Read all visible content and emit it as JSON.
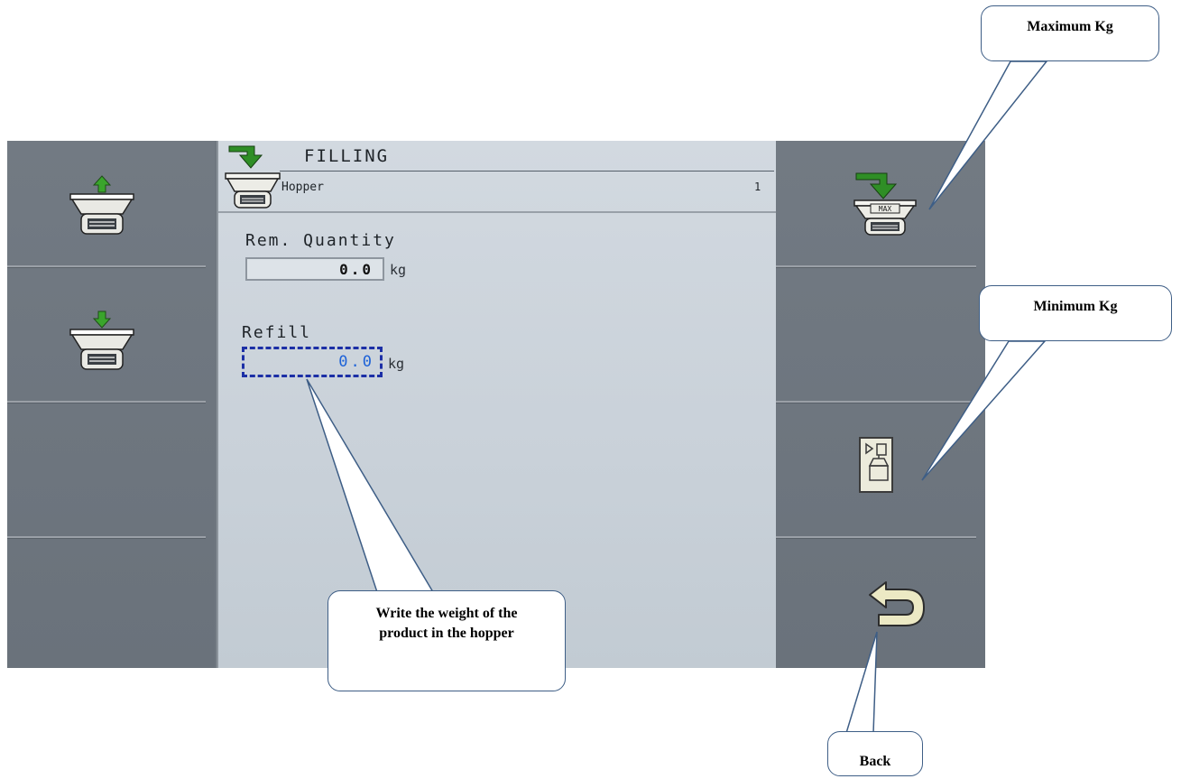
{
  "screen": {
    "title": "FILLING",
    "subtitle": "Hopper",
    "page_number": "1"
  },
  "fields": {
    "remaining_label": "Rem. Quantity",
    "remaining_value": "0.0",
    "remaining_unit": "kg",
    "refill_label": "Refill",
    "refill_value": "0.0",
    "refill_unit": "kg"
  },
  "callouts": {
    "maximum": "Maximum Kg",
    "minimum": "Minimum Kg",
    "write_weight": "Write the weight of the product in the hopper",
    "back": "Back"
  },
  "icons": {
    "left_top": "hopper-fill-up-icon",
    "left_middle": "hopper-fill-down-icon",
    "right_top": "hopper-max-fill-icon",
    "right_third": "scale-min-weight-icon",
    "right_bottom": "back-arrow-icon"
  },
  "colors": {
    "screen_bg": "#6f7780",
    "content_bg": "#cfd6dd",
    "active_field": "#1c2fa6",
    "arrow_green": "#3a8f2a"
  }
}
